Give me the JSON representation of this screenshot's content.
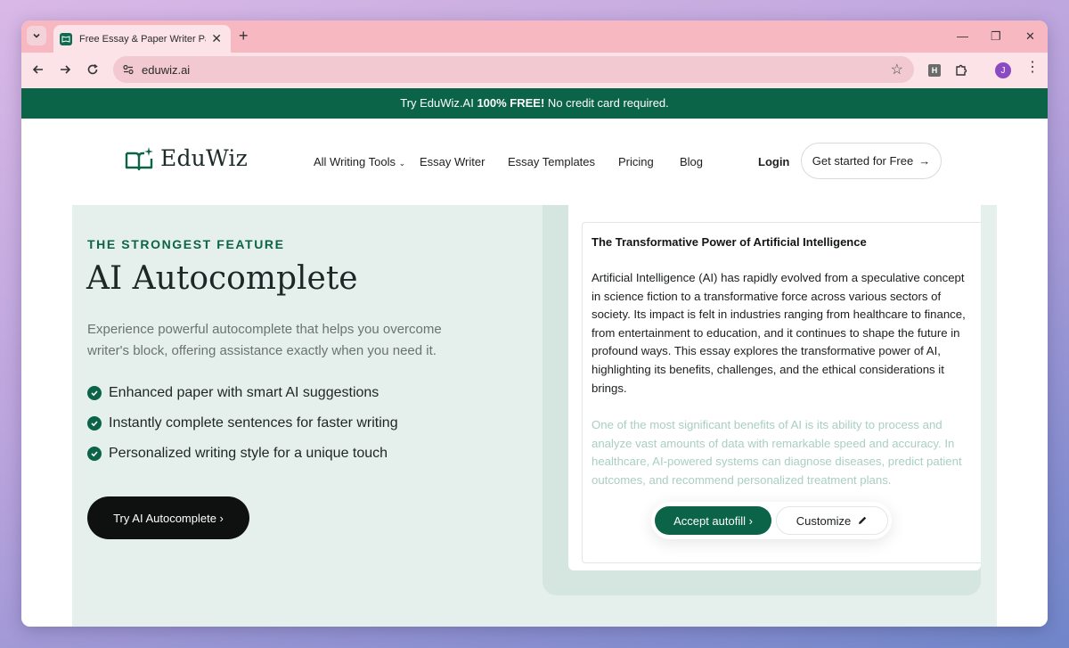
{
  "browser": {
    "tab_title": "Free Essay & Paper Writer Paraphraser",
    "url": "eduwiz.ai",
    "extension_label": "H",
    "profile_initial": "J"
  },
  "banner": {
    "prefix": "Try EduWiz.AI ",
    "bold": "100% FREE!",
    "suffix": " No credit card required."
  },
  "nav": {
    "logo_text": "EduWiz",
    "links": [
      "All Writing Tools",
      "Essay Writer",
      "Essay Templates",
      "Pricing",
      "Blog"
    ],
    "login": "Login",
    "cta": "Get started for Free"
  },
  "hero": {
    "eyebrow": "THE STRONGEST FEATURE",
    "title": "AI Autocomplete",
    "description": "Experience powerful autocomplete that helps you overcome writer's block, offering assistance exactly when you need it.",
    "features": [
      "Enhanced paper with smart AI suggestions",
      "Instantly complete sentences for faster writing",
      "Personalized writing style for a unique touch"
    ],
    "button": "Try AI Autocomplete ›"
  },
  "demo": {
    "essay_title": "The Transformative Power of Artificial Intelligence",
    "essay_paragraph": "Artificial Intelligence (AI) has rapidly evolved from a speculative concept in science fiction to a transformative force across various sectors of society. Its impact is felt in industries ranging from healthcare to finance, from entertainment to education, and it continues to shape the future in profound ways. This essay explores the transformative power of AI, highlighting its benefits, challenges, and the ethical considerations it brings.",
    "suggestion": "One of the most significant benefits of AI is its ability to process and analyze vast amounts of data with remarkable speed and accuracy. In healthcare, AI-powered systems can diagnose diseases, predict patient outcomes, and recommend personalized treatment plans.",
    "accept_label": "Accept autofill ›",
    "customize_label": "Customize"
  },
  "colors": {
    "brand_green": "#0b6348",
    "hero_bg": "#e5f0ec",
    "tab_strip": "#f7b8c2"
  }
}
